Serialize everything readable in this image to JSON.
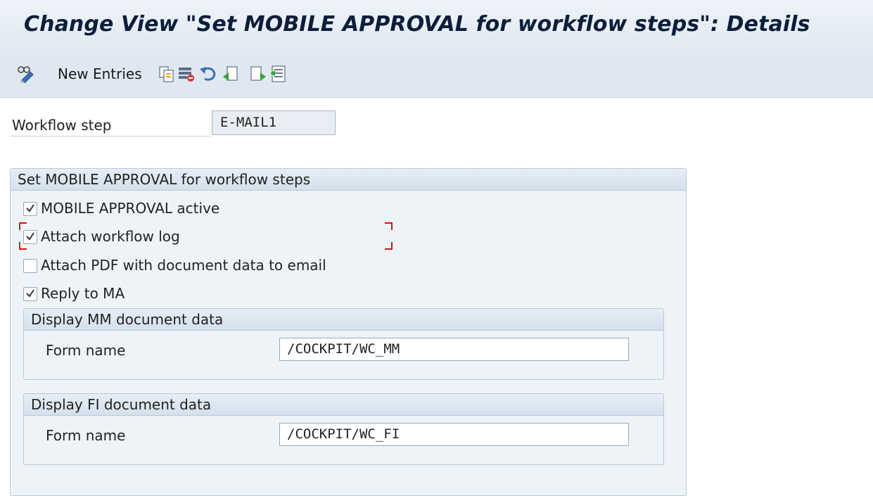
{
  "title": "Change View \"Set MOBILE APPROVAL for workflow steps\": Details",
  "toolbar": {
    "new_entries_label": "New Entries",
    "icons": [
      "glasses-pencil-icon",
      "copy-icon",
      "delete-icon",
      "undo-icon",
      "previous-entry-icon",
      "next-entry-icon",
      "select-block-icon"
    ]
  },
  "workflow_step": {
    "label": "Workflow step",
    "value": "E-MAIL1"
  },
  "main_group": {
    "title": "Set MOBILE APPROVAL for workflow steps",
    "checkboxes": [
      {
        "label": "MOBILE APPROVAL active",
        "checked": true
      },
      {
        "label": "Attach workflow log",
        "checked": true
      },
      {
        "label": "Attach PDF with document data to email",
        "checked": false
      },
      {
        "label": "Reply to MA",
        "checked": true
      }
    ]
  },
  "mm_group": {
    "title": "Display MM document data",
    "form_label": "Form name",
    "form_value": "/COCKPIT/WC_MM"
  },
  "fi_group": {
    "title": "Display FI document data",
    "form_label": "Form name",
    "form_value": "/COCKPIT/WC_FI"
  },
  "colors": {
    "title_text": "#0d1e3a",
    "header_bg": "#dfe8f1",
    "group_bg": "#eef3f8",
    "focus_bracket": "#e01010"
  }
}
